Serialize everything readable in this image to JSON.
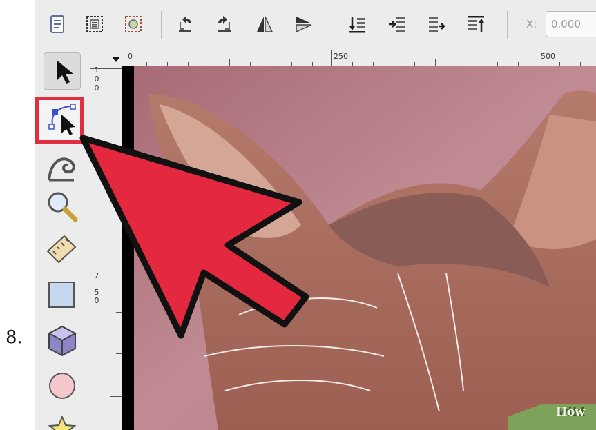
{
  "step_label": "8.",
  "toolbar": {
    "icons": [
      "document-properties-icon",
      "select-all-icon",
      "select-in-all-layers-icon",
      "flip-horizontal-icon",
      "flip-vertical-icon",
      "rotate-left-icon",
      "rotate-right-icon",
      "lower-to-bottom-icon",
      "lower-icon",
      "raise-icon",
      "raise-to-top-icon"
    ],
    "x_label": "X:",
    "x_value": "0.000"
  },
  "tools": [
    "selector-tool-icon",
    "node-editor-tool-icon",
    "tweak-tool-icon",
    "zoom-tool-icon",
    "measure-tool-icon",
    "rectangle-tool-icon",
    "3d-box-tool-icon",
    "ellipse-tool-icon",
    "star-tool-icon"
  ],
  "highlighted_tool": "node-editor-tool-icon",
  "rulers": {
    "horizontal": [
      "0",
      "250",
      "500"
    ],
    "vertical": [
      "1",
      "0",
      "0",
      "7",
      "5",
      "0"
    ]
  },
  "watermark": {
    "part1": "wiki",
    "part2": "How"
  },
  "colors": {
    "highlight": "#e03040",
    "arrow": "#e3283f",
    "canvas": "#b77a82"
  }
}
